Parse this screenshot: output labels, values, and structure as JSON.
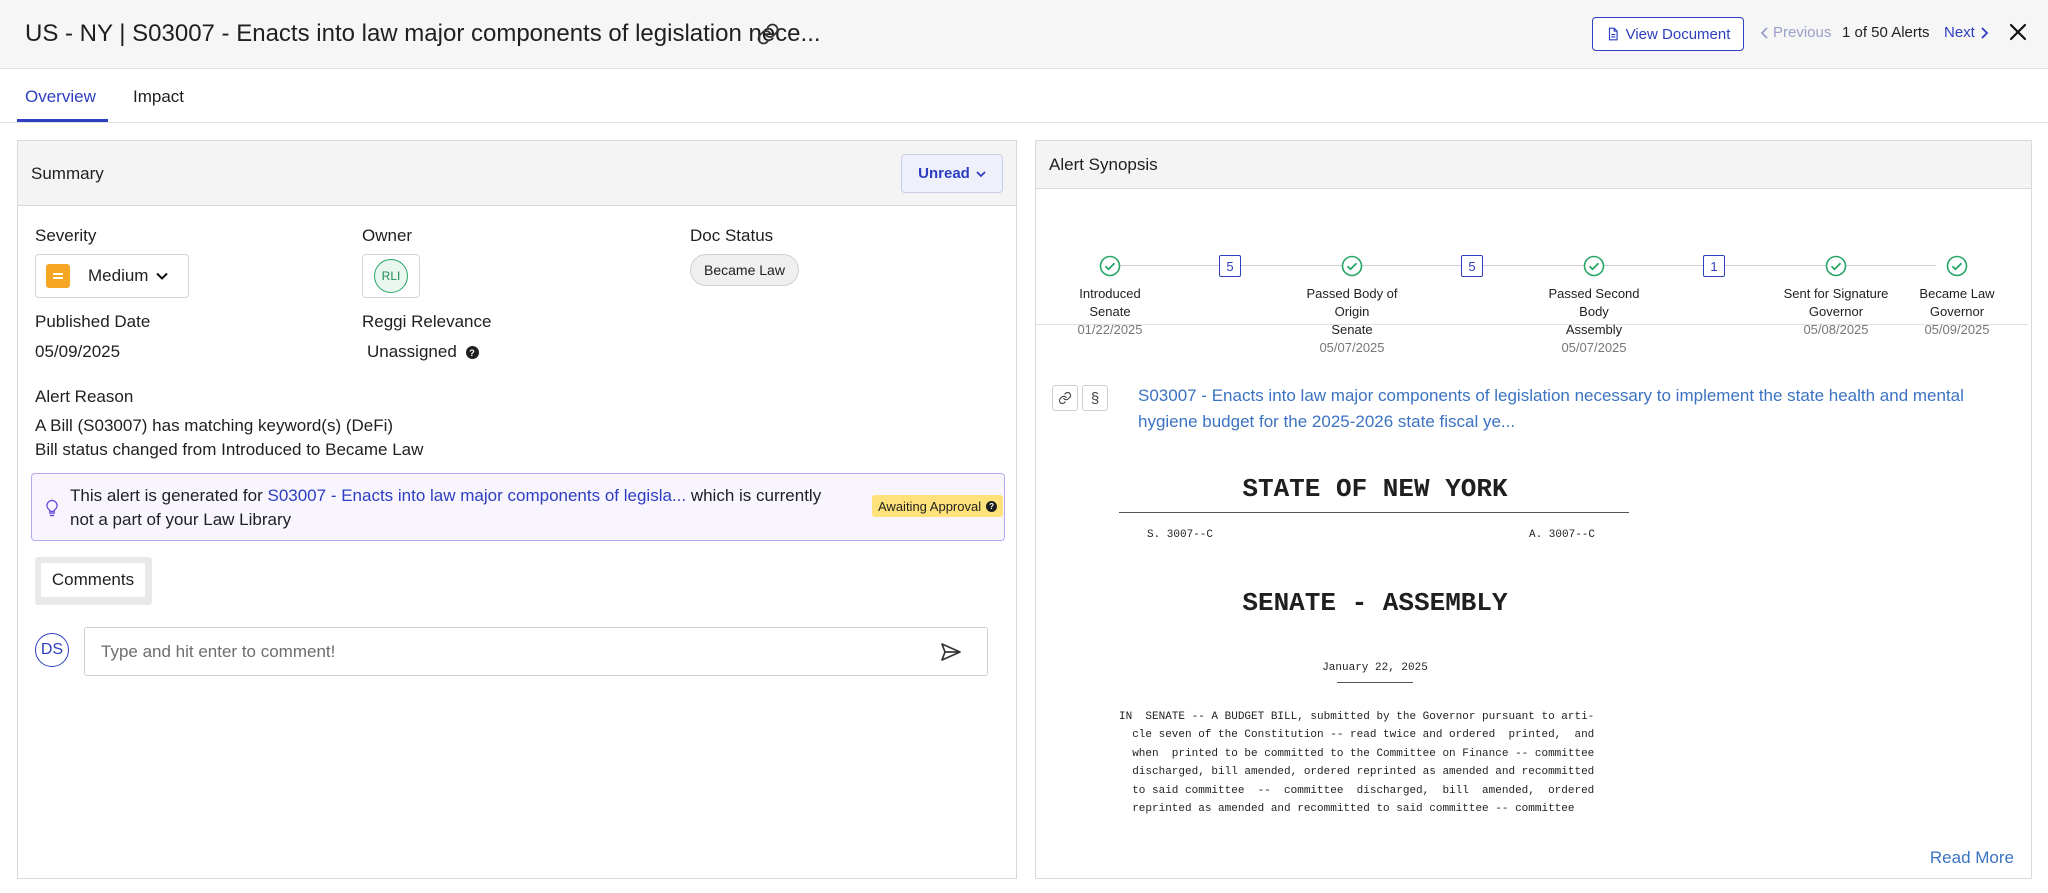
{
  "header": {
    "title": "US - NY | S03007 - Enacts into law major components of legislation nece...",
    "view_document_label": "View Document",
    "previous_label": "Previous",
    "count_label": "1 of 50 Alerts",
    "next_label": "Next"
  },
  "tabs": [
    {
      "label": "Overview",
      "active": true
    },
    {
      "label": "Impact",
      "active": false
    }
  ],
  "summary": {
    "title": "Summary",
    "read_status": "Unread",
    "severity_label": "Severity",
    "severity_value": "Medium",
    "owner_label": "Owner",
    "owner_initials": "RLI",
    "doc_status_label": "Doc Status",
    "doc_status_value": "Became Law",
    "published_date_label": "Published Date",
    "published_date_value": "05/09/2025",
    "relevance_label": "Reggi Relevance",
    "relevance_value": "Unassigned",
    "alert_reason_label": "Alert Reason",
    "alert_reason_line1": "A Bill (S03007) has matching keyword(s) (DeFi)",
    "alert_reason_line2": "Bill status changed from Introduced to Became Law",
    "notice_prefix": "This alert is generated for ",
    "notice_link": "S03007 - Enacts into law major components of legisla...",
    "notice_suffix": " which is currently not a part of your Law Library",
    "awaiting_badge": "Awaiting Approval",
    "comments_label": "Comments",
    "user_initials": "DS",
    "comment_placeholder": "Type and hit enter to comment!"
  },
  "synopsis": {
    "title": "Alert Synopsis",
    "stages": [
      {
        "label": "Introduced\nSenate",
        "date": "01/22/2025"
      },
      {
        "label": "Passed Body of\nOrigin\nSenate",
        "date": "05/07/2025"
      },
      {
        "label": "Passed Second\nBody\nAssembly",
        "date": "05/07/2025"
      },
      {
        "label": "Sent for Signature\nGovernor",
        "date": "05/08/2025"
      },
      {
        "label": "Became Law\nGovernor",
        "date": "05/09/2025"
      }
    ],
    "gap_counts": [
      "5",
      "5",
      "1"
    ],
    "section_symbol": "§",
    "bill_link": "S03007 - Enacts into law major components of legislation necessary to implement the state health and mental hygiene budget for the 2025-2026 state fiscal ye...",
    "document": {
      "heading": "STATE OF NEW YORK",
      "senate_no": "S. 3007--C",
      "assembly_no": "A. 3007--C",
      "subheading": "SENATE - ASSEMBLY",
      "date": "January 22, 2025",
      "body": "IN  SENATE -- A BUDGET BILL, submitted by the Governor pursuant to arti-\n  cle seven of the Constitution -- read twice and ordered  printed,  and\n  when  printed to be committed to the Committee on Finance -- committee\n  discharged, bill amended, ordered reprinted as amended and recommitted\n  to said committee  --  committee  discharged,  bill  amended,  ordered\n  reprinted as amended and recommitted to said committee -- committee"
    },
    "read_more_label": "Read More"
  },
  "colors": {
    "accent": "#2d3ec0",
    "link": "#3b73c2",
    "check_green": "#27a567",
    "severity_medium": "#f5a623",
    "awaiting_yellow": "#ffe27a"
  }
}
